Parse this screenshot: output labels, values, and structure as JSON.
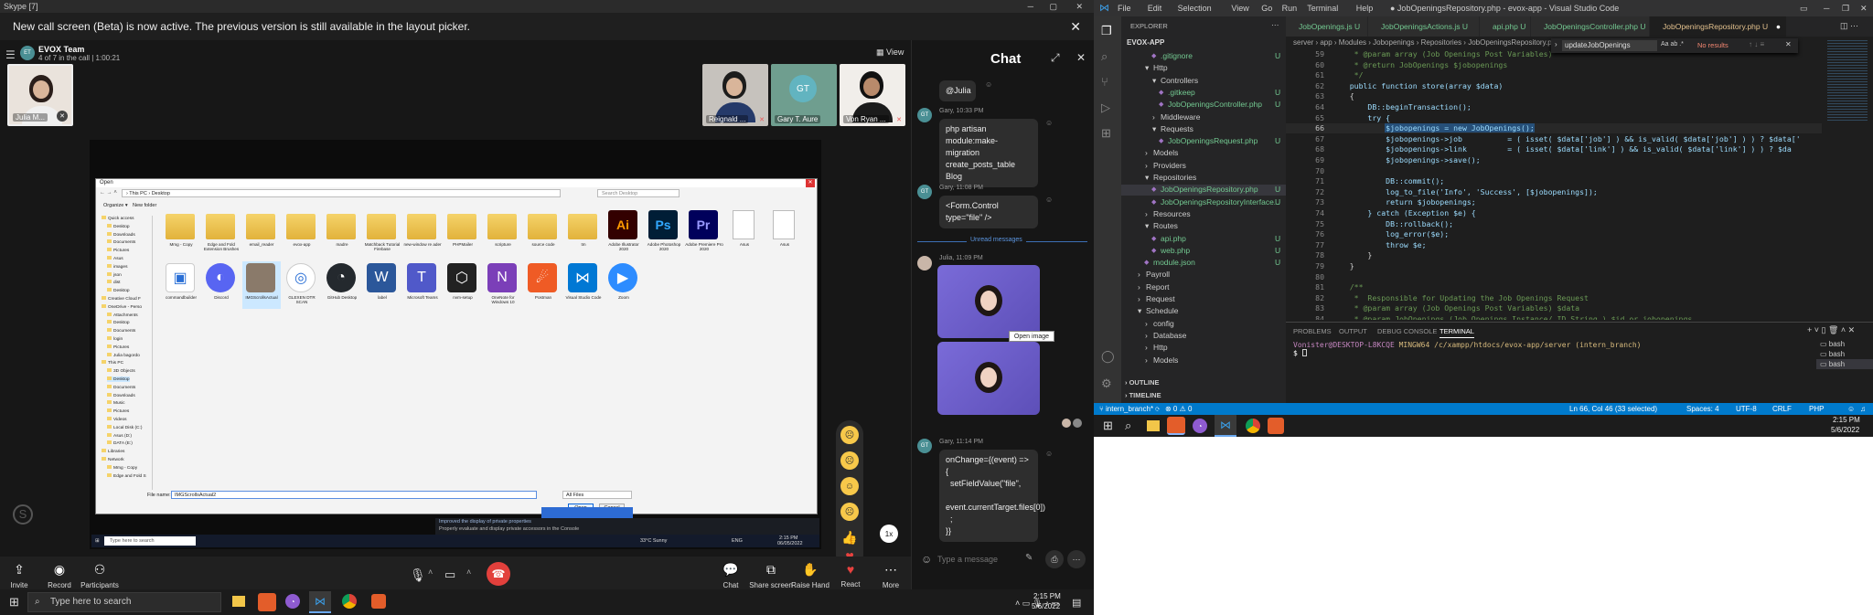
{
  "skype": {
    "window_title": "Skype [7]",
    "banner": "New call screen (Beta) is now active. The previous version is still available in the layout picker.",
    "call": {
      "avatar_initials": "ET",
      "team": "EVOX Team",
      "subtitle": "4 of 7 in the call | 1:00:21",
      "view_label": "View",
      "chat_title": "Chat"
    },
    "participants": [
      {
        "name": "Julia M...",
        "initials": ""
      },
      {
        "name": "Reignald ...",
        "initials": ""
      },
      {
        "name": "Gary T. Aure",
        "initials": "GT"
      },
      {
        "name": "Von Ryan ...",
        "initials": ""
      }
    ],
    "shared": {
      "dialog_title": "Open",
      "breadcrumb": "› This PC › Desktop",
      "search": "Search Desktop",
      "organize": "Organize ▾",
      "new_folder": "New folder",
      "nav": [
        "Quick access",
        "Desktop",
        "Downloads",
        "Documents",
        "Pictures",
        "Asus",
        "images",
        "json",
        "dist",
        "Desktop",
        "Creative Cloud F",
        "OneDrive - Perso",
        "Attachments",
        "Desktop",
        "Documents",
        "login",
        "Pictures",
        "Julia bagordo",
        "This PC",
        "3D Objects",
        "Desktop",
        "Documents",
        "Downloads",
        "Music",
        "Pictures",
        "Videos",
        "Local Disk (C:)",
        "Asus (D:)",
        "DATA (E:)",
        "Libraries",
        "Network",
        "Mmg - Copy",
        "Edge and Fold S"
      ],
      "row1": [
        "Mmg - Copy",
        "Edge and Fold Extension Brushes",
        "email_reader",
        "evox-app",
        "madre",
        "Matchback Tutorial Firebase",
        "new-window re ader",
        "PHPMailer",
        "scripture",
        "source code",
        "tm",
        "Adobe Illustrator 2020",
        "Adobe Photoshop 2020",
        "Adobe Premiere Pro 2020",
        "Asus",
        "Asus"
      ],
      "row2": [
        "commandbuilder",
        "Discord",
        "IMGScrollsActual",
        "GLEXEN DTR SCAN",
        "GitHub Desktop",
        "label",
        "Microsoft Teams",
        "nvm-setup",
        "OneNote for Windows 10",
        "Postman",
        "Visual Studio Code",
        "Zoom"
      ],
      "filename_label": "File name:",
      "filename": "IMGScrollsActual2",
      "filetype": "All Files",
      "open": "Open",
      "cancel": "Cancel",
      "taskbar_search": "Type here to search",
      "weather": "33°C  Sunny",
      "tray_lang": "ENG",
      "time": "2:15 PM",
      "date": "06/05/2022",
      "popup_lines": [
        "Improved the display of private properties",
        "Properly evaluate and display private accessors in the Console"
      ]
    },
    "controls": {
      "invite": "Invite",
      "record": "Record",
      "participants": "Participants",
      "chat": "Chat",
      "share": "Share screen",
      "raise": "Raise Hand",
      "react": "React",
      "more": "More",
      "speed": "1x"
    },
    "chat": {
      "top_bubble": "@Julia",
      "m1_meta": "Gary, 10:33 PM",
      "m1": "php artisan module:make-migration create_posts_table Blog",
      "m2_meta": "Gary, 11:08 PM",
      "m2": "<Form.Control type=\"file\" />",
      "unread": "Unread messages",
      "m3_meta": "Julia, 11:09 PM",
      "open_image": "Open image",
      "m4_meta": "Gary, 11:14 PM",
      "m4": "onChange={(event) => {\n  setFieldValue(\"file\",\n  event.currentTarget.files[0])\n  ;\n}}",
      "placeholder": "Type a message"
    },
    "taskbar": {
      "search": "Type here to search",
      "time": "2:15 PM",
      "date": "5/6/2022"
    }
  },
  "vscode": {
    "menus": [
      "File",
      "Edit",
      "Selection",
      "View",
      "Go",
      "Run",
      "Terminal",
      "Help"
    ],
    "title": "● JobOpeningsRepository.php - evox-app - Visual Studio Code",
    "explorer_label": "EXPLORER",
    "root": "EVOX-APP",
    "tree": [
      {
        "t": ".gitignore",
        "i": 3,
        "m": true
      },
      {
        "t": "Http",
        "i": 2,
        "m": false,
        "f": "▾"
      },
      {
        "t": "Controllers",
        "i": 3,
        "m": false,
        "f": "▾"
      },
      {
        "t": ".gitkeep",
        "i": 4,
        "m": true
      },
      {
        "t": "JobOpeningsController.php",
        "i": 4,
        "m": true
      },
      {
        "t": "Middleware",
        "i": 3,
        "m": false,
        "f": "›"
      },
      {
        "t": "Requests",
        "i": 3,
        "m": false,
        "f": "▾"
      },
      {
        "t": "JobOpeningsRequest.php",
        "i": 4,
        "m": true
      },
      {
        "t": "Models",
        "i": 2,
        "m": false,
        "f": "›"
      },
      {
        "t": "Providers",
        "i": 2,
        "m": false,
        "f": "›"
      },
      {
        "t": "Repositories",
        "i": 2,
        "m": false,
        "f": "▾"
      },
      {
        "t": "JobOpeningsRepository.php",
        "i": 3,
        "m": true,
        "sel": true
      },
      {
        "t": "JobOpeningsRepositoryInterface...",
        "i": 3,
        "m": true
      },
      {
        "t": "Resources",
        "i": 2,
        "m": false,
        "f": "›"
      },
      {
        "t": "Routes",
        "i": 2,
        "m": false,
        "f": "▾"
      },
      {
        "t": "api.php",
        "i": 3,
        "m": true
      },
      {
        "t": "web.php",
        "i": 3,
        "m": true
      },
      {
        "t": "module.json",
        "i": 2,
        "m": true
      },
      {
        "t": "Payroll",
        "i": 1,
        "m": false,
        "f": "›"
      },
      {
        "t": "Report",
        "i": 1,
        "m": false,
        "f": "›"
      },
      {
        "t": "Request",
        "i": 1,
        "m": false,
        "f": "›"
      },
      {
        "t": "Schedule",
        "i": 1,
        "m": false,
        "f": "▾"
      },
      {
        "t": "config",
        "i": 2,
        "m": false,
        "f": "›"
      },
      {
        "t": "Database",
        "i": 2,
        "m": false,
        "f": "›"
      },
      {
        "t": "Http",
        "i": 2,
        "m": false,
        "f": "›"
      },
      {
        "t": "Models",
        "i": 2,
        "m": false,
        "f": "›"
      }
    ],
    "outline": "OUTLINE",
    "timeline": "TIMELINE",
    "tabs": [
      "JobOpenings.js U",
      "JobOpeningsActions.js U",
      "api.php U",
      "JobOpeningsController.php U",
      "JobOpeningsRepository.php U"
    ],
    "breadcrumb": "server › app › Modules › Jobopenings › Repositories › JobOpeningsRepository.php",
    "find": {
      "value": "updateJobOpenings",
      "result": "No results"
    },
    "lines": [
      {
        "n": "59",
        "c": "     * @param array (Job Openings Post Variables)"
      },
      {
        "n": "60",
        "c": "     * @return JobOpenings $jobopenings"
      },
      {
        "n": "61",
        "c": "     */"
      },
      {
        "n": "62",
        "c": "    public function store(array $data)"
      },
      {
        "n": "63",
        "c": "    {"
      },
      {
        "n": "64",
        "c": "        DB::beginTransaction();"
      },
      {
        "n": "65",
        "c": "        try {"
      },
      {
        "n": "66",
        "c": "            $jobopenings = new JobOpenings();"
      },
      {
        "n": "67",
        "c": "            $jobopenings->job          = ( isset( $data['job'] ) && is_valid( $data['job'] ) ) ? $data['"
      },
      {
        "n": "68",
        "c": "            $jobopenings->link         = ( isset( $data['link'] ) && is_valid( $data['link'] ) ) ? $da"
      },
      {
        "n": "69",
        "c": "            $jobopenings->save();"
      },
      {
        "n": "70",
        "c": ""
      },
      {
        "n": "71",
        "c": "            DB::commit();"
      },
      {
        "n": "72",
        "c": "            log_to_file('Info', 'Success', [$jobopenings]);"
      },
      {
        "n": "73",
        "c": "            return $jobopenings;"
      },
      {
        "n": "74",
        "c": "        } catch (Exception $e) {"
      },
      {
        "n": "75",
        "c": "            DB::rollback();"
      },
      {
        "n": "76",
        "c": "            log_error($e);"
      },
      {
        "n": "77",
        "c": "            throw $e;"
      },
      {
        "n": "78",
        "c": "        }"
      },
      {
        "n": "79",
        "c": "    }"
      },
      {
        "n": "80",
        "c": ""
      },
      {
        "n": "81",
        "c": "    /**"
      },
      {
        "n": "82",
        "c": "     *  Responsible for Updating the Job Openings Request"
      },
      {
        "n": "83",
        "c": "     * @param array (Job Openings Post Variables) $data"
      },
      {
        "n": "84",
        "c": "     * @param JobOpenings (Job Openings Instance/ ID String ) $id_or_jobopenings"
      }
    ],
    "term_tabs": [
      "PROBLEMS",
      "OUTPUT",
      "DEBUG CONSOLE",
      "TERMINAL"
    ],
    "term_line1_user": "Vonister@DESKTOP-L8KCQE",
    "term_line1_rest": " MINGW64 /c/xampp/htdocs/evox-app/server (intern_branch)",
    "term_prompt": "$ ",
    "shells": [
      "bash",
      "bash",
      "bash"
    ],
    "status_left": [
      "intern_branch*",
      "⊗ 0 ⚠ 0"
    ],
    "status_right": [
      "Ln 66, Col 46 (33 selected)",
      "Spaces: 4",
      "UTF-8",
      "CRLF",
      "PHP"
    ],
    "time": "2:15 PM",
    "date": "5/6/2022"
  }
}
